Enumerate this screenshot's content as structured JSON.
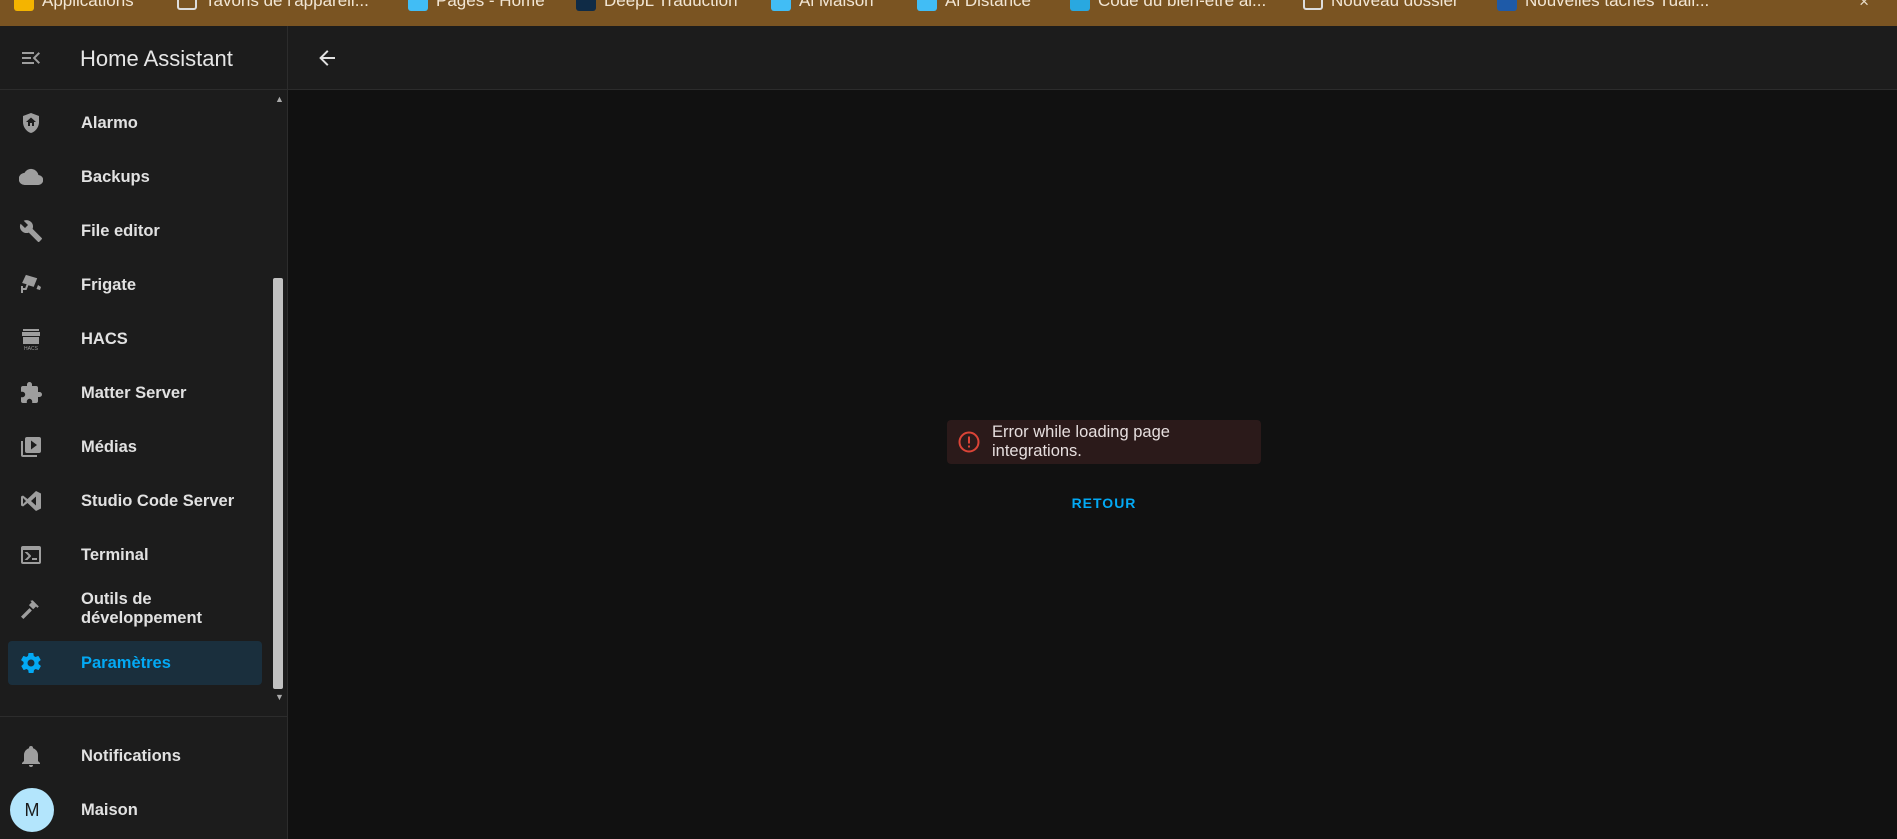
{
  "browser": {
    "bookmarks": [
      {
        "label": "Applications",
        "color": "#f4b400"
      },
      {
        "label": "Tavoris de l'appareil...",
        "color": "#dddddd"
      },
      {
        "label": "Pages - Home",
        "color": "#41bdf5"
      },
      {
        "label": "DeepL Traduction",
        "color": "#0f2b46"
      },
      {
        "label": "Al Maison",
        "color": "#41bdf5"
      },
      {
        "label": "Al Distance",
        "color": "#41bdf5"
      },
      {
        "label": "Code du bien-être al...",
        "color": "#29a8e0"
      },
      {
        "label": "Nouveau dossier",
        "color": "#dddddd"
      },
      {
        "label": "Nouvelles taches Tuali...",
        "color": "#1e5aa8"
      }
    ],
    "close_glyph": "×"
  },
  "sidebar": {
    "title": "Home Assistant",
    "items": [
      {
        "label": "Alarmo",
        "icon": "shield-home-icon"
      },
      {
        "label": "Backups",
        "icon": "cloud-icon"
      },
      {
        "label": "File editor",
        "icon": "wrench-icon"
      },
      {
        "label": "Frigate",
        "icon": "cctv-icon"
      },
      {
        "label": "HACS",
        "icon": "hacs-icon"
      },
      {
        "label": "Matter Server",
        "icon": "puzzle-icon"
      },
      {
        "label": "Médias",
        "icon": "play-box-multiple-icon"
      },
      {
        "label": "Studio Code Server",
        "icon": "vscode-icon"
      },
      {
        "label": "Terminal",
        "icon": "console-icon"
      },
      {
        "label": "Outils de développement",
        "icon": "hammer-icon"
      },
      {
        "label": "Paramètres",
        "icon": "cog-icon",
        "active": true
      }
    ],
    "notifications_label": "Notifications",
    "user_initial": "M",
    "user_label": "Maison"
  },
  "main": {
    "error_text": "Error while loading page integrations.",
    "back_label": "RETOUR"
  },
  "colors": {
    "accent": "#03a9f4",
    "error": "#db4437",
    "background": "#111111",
    "sidebar": "#1c1c1c"
  }
}
